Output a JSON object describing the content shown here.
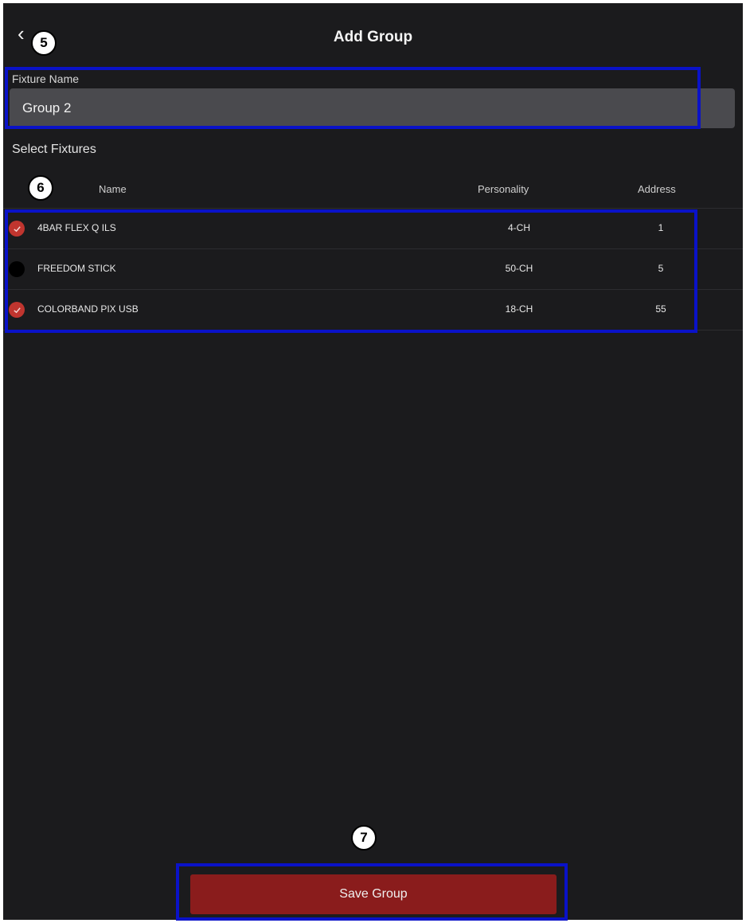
{
  "header": {
    "back_icon": "chevron-left-icon",
    "back_glyph": "‹",
    "title": "Add Group"
  },
  "annotations": {
    "badge_back": "5",
    "badge_fixtures": "6",
    "badge_save": "7",
    "highlight_color": "#0a12c8"
  },
  "form": {
    "name_label": "Fixture Name",
    "name_value": "Group 2"
  },
  "fixtures": {
    "section_label": "Select Fixtures",
    "columns": {
      "name": "Name",
      "personality": "Personality",
      "address": "Address"
    },
    "rows": [
      {
        "selected": true,
        "name": "4BAR FLEX Q ILS",
        "personality": "4-CH",
        "address": "1"
      },
      {
        "selected": false,
        "name": "FREEDOM STICK",
        "personality": "50-CH",
        "address": "5"
      },
      {
        "selected": true,
        "name": "COLORBAND PIX USB",
        "personality": "18-CH",
        "address": "55"
      }
    ],
    "check_color": "#c0352f"
  },
  "footer": {
    "save_label": "Save Group",
    "save_color": "#8a1c1c"
  }
}
